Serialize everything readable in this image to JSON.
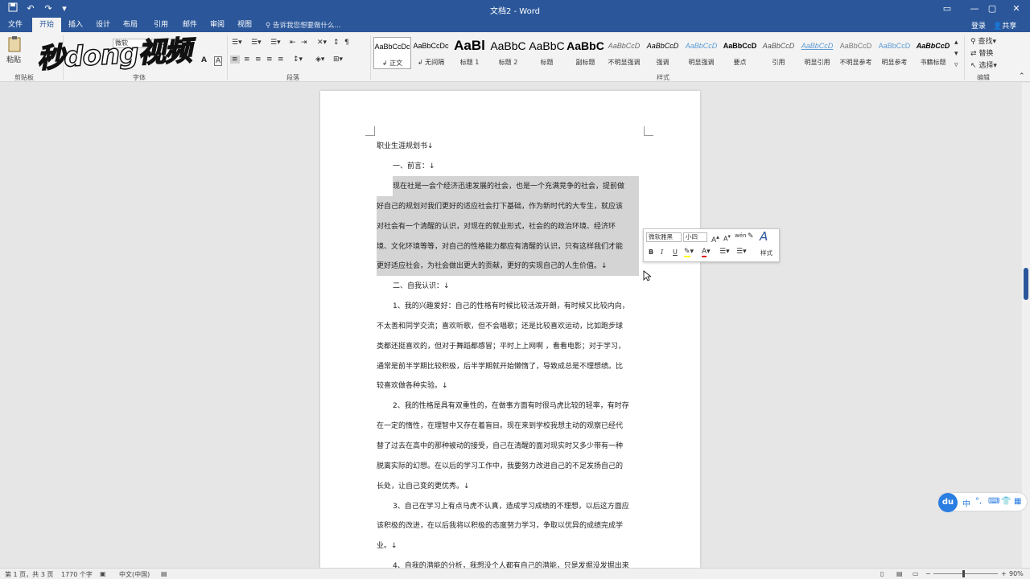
{
  "window": {
    "title": "文档2 - Word",
    "login": "登录",
    "share": "共享",
    "restore_icon": "ribbon-display-icon",
    "minimize": "—",
    "maximize": "▢",
    "close": "✕"
  },
  "tabs": [
    "文件",
    "开始",
    "插入",
    "设计",
    "布局",
    "引用",
    "邮件",
    "审阅",
    "视图"
  ],
  "tell_me": "告诉我您想要做什么...",
  "ribbon": {
    "paste": "粘贴",
    "groups": {
      "clipboard": "剪贴板",
      "font": "字体",
      "paragraph": "段落",
      "styles": "样式",
      "editing": "编辑"
    },
    "font_name": "微软",
    "font_size": "小四",
    "styles": [
      {
        "preview": "AaBbCcDc",
        "name": "正文"
      },
      {
        "preview": "AaBbCcDc",
        "name": "无间隔"
      },
      {
        "preview": "AaBl",
        "name": "标题 1"
      },
      {
        "preview": "AaBbC",
        "name": "标题 2"
      },
      {
        "preview": "AaBbC",
        "name": "标题"
      },
      {
        "preview": "AaBbC",
        "name": "副标题"
      },
      {
        "preview": "AaBbCcD",
        "name": "不明显强调"
      },
      {
        "preview": "AaBbCcD",
        "name": "强调"
      },
      {
        "preview": "AaBbCcD",
        "name": "明显强调"
      },
      {
        "preview": "AaBbCcD",
        "name": "要点"
      },
      {
        "preview": "AaBbCcD",
        "name": "引用"
      },
      {
        "preview": "AaBbCcD",
        "name": "明显引用"
      },
      {
        "preview": "AaBbCcD",
        "name": "不明显参考"
      },
      {
        "preview": "AaBbCcD",
        "name": "明显参考"
      },
      {
        "preview": "AaBbCcD",
        "name": "书籍标题"
      }
    ],
    "editing": {
      "find": "查找",
      "replace": "替换",
      "select": "选择"
    }
  },
  "watermark": "秒dong视频",
  "document": {
    "lines": [
      "职业生涯规划书↓",
      "一、前言：↓",
      "现在社是一会个经济迅速发展的社会，也是一个充满竞争的社会，提前做",
      "好自己的规划对我们更好的适应社会打下基础，作为新时代的大专生，就应该",
      "对社会有一个清醒的认识，对现在的就业形式，社会的的政治环境、经济环",
      "境、文化环境等等，对自己的性格能力都应有清醒的认识，只有这样我们才能",
      "更好适应社会，为社会做出更大的贡献，更好的实现自己的人生价值。↓",
      "二、自我认识：↓",
      "1、我的兴趣爱好：自己的性格有时候比较活泼开朗，有时候又比较内向，",
      "不太善和同学交流；喜欢听歌，但不会唱歌；还是比较喜欢运动，比如跑步球",
      "类都还挺喜欢的，但对于舞蹈都感冒；平时上上网啊 ，看看电影；对于学习，",
      "通常是前半学期比较积极，后半学期就开始懒惰了，导致成总是不理想绩。比",
      "较喜欢做各种实验。↓",
      "2、我的性格是具有双重性的，在做事方面有时很马虎比较的轻率，有时存",
      "在一定的惰性，在理智中又存在着盲目。现在来到学校我想主动的观察已经代",
      "替了过去在高中的那种被动的接受，自己在清醒的面对现实时又多少带有一种",
      "脱离实际的幻想。在以后的学习工作中，我要努力改进自己的不足发扬自己的",
      "长处，让自己变的更优秀。↓",
      "3、自己在学习上有点马虎不认真，造成学习成绩的不理想，以后这方面应",
      "该积极的改进，在以后我将以积极的态度努力学习，争取以优异的成绩完成学",
      "业。↓",
      "4、自我的潜能的分析，我想没个人都有自己的潜能，只是发掘没发掘出来"
    ]
  },
  "mini_toolbar": {
    "font": "微软雅黑",
    "size": "小四",
    "bold": "B",
    "italic": "I",
    "underline": "U",
    "styles_label": "样式"
  },
  "status": {
    "page": "第 1 页，共 3 页",
    "words": "1770 个字",
    "language": "中文(中国)",
    "zoom": "90%"
  },
  "ime": {
    "logo": "du",
    "mode": "中"
  }
}
